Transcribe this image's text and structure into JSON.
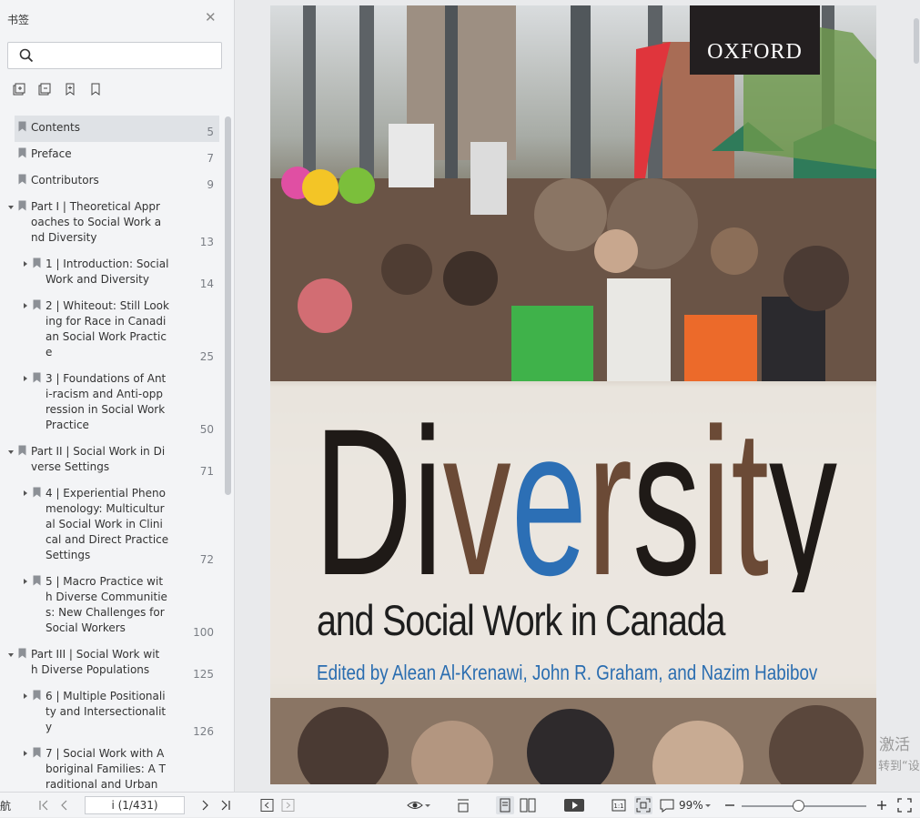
{
  "sidebar": {
    "title": "书签",
    "close_icon": "close-icon",
    "search_placeholder": "",
    "tool_icons": [
      "expand-all-icon",
      "collapse-all-icon",
      "bookmark-add-icon",
      "bookmark-icon"
    ],
    "items": [
      {
        "label": "Contents",
        "page": "5",
        "level": 0,
        "expander": "none",
        "selected": true
      },
      {
        "label": "Preface",
        "page": "7",
        "level": 0,
        "expander": "none"
      },
      {
        "label": "Contributors",
        "page": "9",
        "level": 0,
        "expander": "none"
      },
      {
        "label": "Part I | Theoretical Appr\noaches to Social Work a\nnd Diversity",
        "page": "13",
        "level": 0,
        "expander": "expanded"
      },
      {
        "label": "1 | Introduction: Social\nWork and Diversity",
        "page": "14",
        "level": 1,
        "expander": "collapsed"
      },
      {
        "label": "2 | Whiteout: Still Look\ning for Race in Canadi\nan Social Work Practic\ne",
        "page": "25",
        "level": 1,
        "expander": "collapsed"
      },
      {
        "label": "3 | Foundations of Ant\ni-racism and Anti-opp\nression in Social Work\nPractice",
        "page": "50",
        "level": 1,
        "expander": "collapsed"
      },
      {
        "label": "Part II | Social Work in Di\nverse Settings",
        "page": "71",
        "level": 0,
        "expander": "expanded"
      },
      {
        "label": "4 | Experiential Pheno\nmenology: Multicultur\nal Social Work in Clini\ncal and Direct Practice\nSettings",
        "page": "72",
        "level": 1,
        "expander": "collapsed"
      },
      {
        "label": "5 | Macro Practice wit\nh Diverse Communitie\ns: New Challenges for\nSocial Workers",
        "page": "100",
        "level": 1,
        "expander": "collapsed"
      },
      {
        "label": "Part III | Social Work wit\nh Diverse Populations",
        "page": "125",
        "level": 0,
        "expander": "expanded"
      },
      {
        "label": "6 | Multiple Positionali\nty and Intersectionalit\ny",
        "page": "126",
        "level": 1,
        "expander": "collapsed"
      },
      {
        "label": "7 | Social Work with A\nboriginal Families: A T\nraditional and Urban",
        "page": "",
        "level": 1,
        "expander": "collapsed"
      }
    ]
  },
  "cover": {
    "publisher": "OXFORD",
    "title": "Diversity",
    "subtitle": "and Social Work in Canada",
    "editors": "Edited by Alean Al-Krenawi, John R. Graham, and Nazim Habibov",
    "title_colors": {
      "dark": "#1f1a17",
      "blue": "#2c6fb5",
      "brown": "#6b4a36"
    }
  },
  "watermark": {
    "line1": "激活",
    "line2": "转到“设"
  },
  "toolbar": {
    "nav_label": "航",
    "page_value": "i (1/431)",
    "zoom_label": "99%",
    "icons": [
      "first-page-icon",
      "prev-page-icon",
      "next-page-icon",
      "last-page-icon",
      "prev-view-icon",
      "next-view-icon",
      "eye-icon",
      "fit-width-icon",
      "single-page-icon",
      "two-page-icon",
      "play-icon",
      "actual-size-icon",
      "fit-page-icon",
      "comment-icon",
      "zoom-out-icon",
      "zoom-in-icon",
      "fullscreen-icon"
    ],
    "zoom_level": 0.45
  }
}
